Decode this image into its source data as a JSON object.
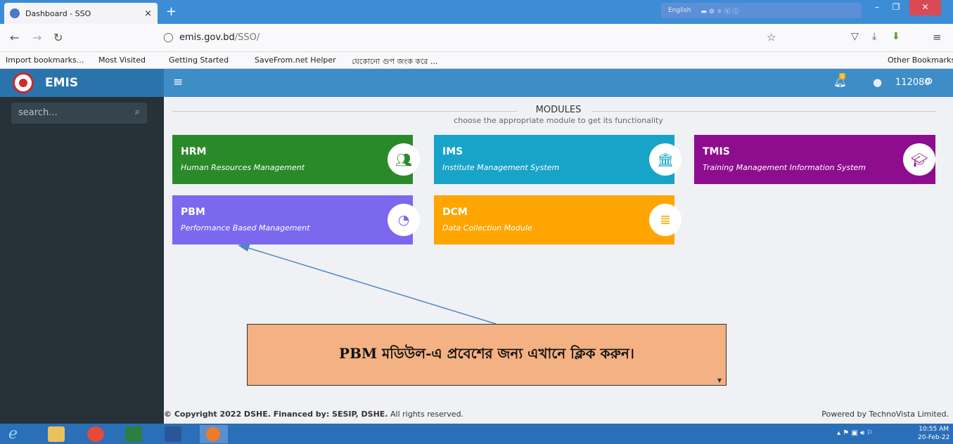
{
  "browser": {
    "tab_title": "Dashboard - SSO",
    "tab_close": "×",
    "new_tab": "+",
    "lang_label": "English",
    "url_host": "emis.gov.bd",
    "url_path": "/SSO/",
    "bookmarks": [
      "Import bookmarks...",
      "Most Visited",
      "Getting Started",
      "SaveFrom.net Helper",
      "যেকোনো গুপ জংক করে ..."
    ],
    "other_bookmarks": "Other Bookmarks"
  },
  "app": {
    "name": "EMIS",
    "notification_count": "0",
    "user_id": "112080"
  },
  "sidebar": {
    "search_placeholder": "search..."
  },
  "main": {
    "title": "MODULES",
    "subtitle": "choose the appropriate module to get its functionality",
    "modules": [
      {
        "code": "HRM",
        "name": "Human Resources Management",
        "color": "#2a8a2a",
        "icon": "users-icon"
      },
      {
        "code": "IMS",
        "name": "Institute Management System",
        "color": "#18a3c9",
        "icon": "bank-icon"
      },
      {
        "code": "TMIS",
        "name": "Training Management Information System",
        "color": "#8e0d8e",
        "icon": "graduation-cap-icon"
      },
      {
        "code": "PBM",
        "name": "Performance Based Management",
        "color": "#7b68ee",
        "icon": "dashboard-gauge-icon"
      },
      {
        "code": "DCM",
        "name": "Data Collection Module",
        "color": "#ffa500",
        "icon": "database-icon"
      }
    ]
  },
  "footer": {
    "copyright_bold": "© Copyright 2022 DSHE. Financed by: SESIP, DSHE.",
    "copyright_rest": " All rights reserved.",
    "powered": "Powered by TechnoVista Limited."
  },
  "callout": {
    "text": "PBM মডিউল-এ প্রবেশের জন্য এখানে ক্লিক করুন।"
  },
  "taskbar": {
    "time": "10:55 AM",
    "date": "20-Feb-22"
  }
}
